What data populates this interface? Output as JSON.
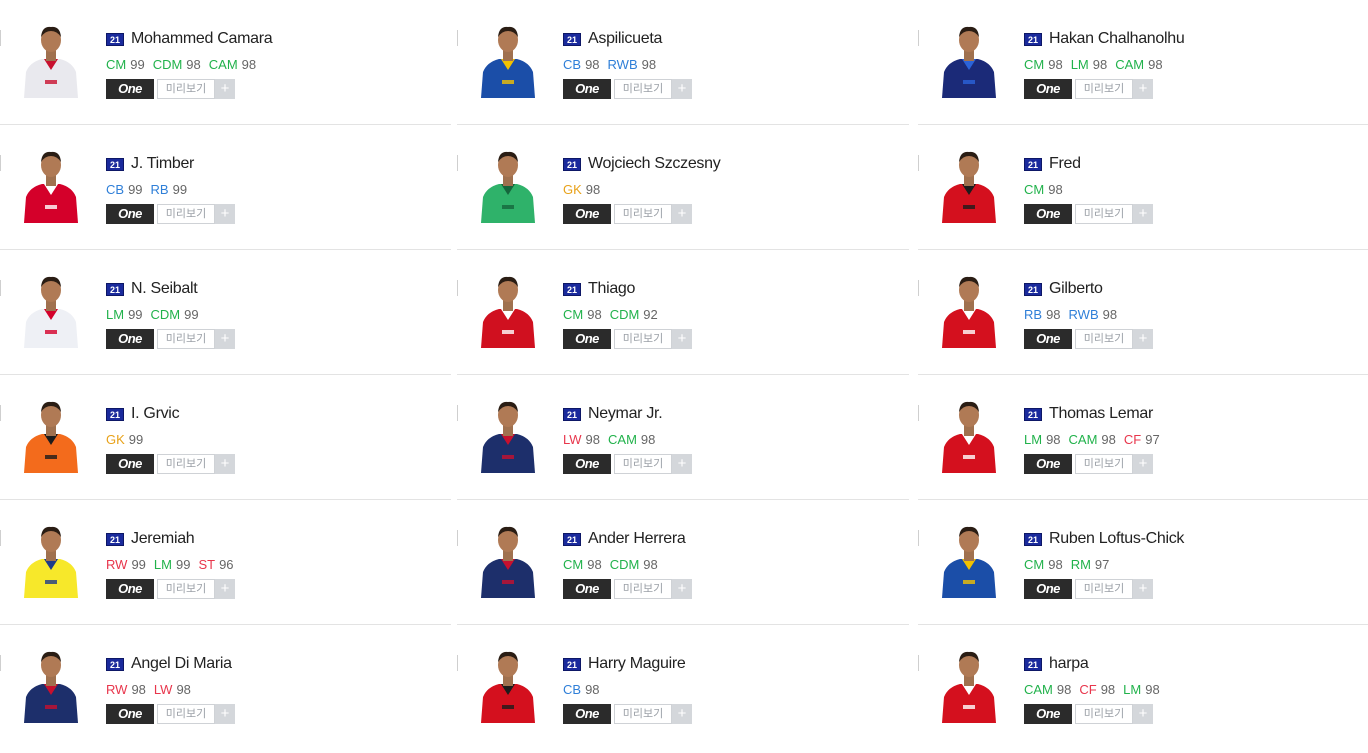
{
  "colors": {
    "CM": "#21b24b",
    "CDM": "#21b24b",
    "CAM": "#21b24b",
    "LM": "#21b24b",
    "RM": "#21b24b",
    "CB": "#2f7fd8",
    "RB": "#2f7fd8",
    "RWB": "#2f7fd8",
    "GK": "#e8a21a",
    "RW": "#e8364c",
    "LW": "#e8364c",
    "ST": "#e8364c",
    "CF": "#e8364c"
  },
  "labels": {
    "season": "21",
    "one": "One",
    "preview": "미리보기",
    "plus": "+"
  },
  "columns": [
    [
      {
        "name": "Mohammed Camara",
        "kit": "#e9e9ee",
        "kit2": "#c8102e",
        "positions": [
          {
            "code": "CM",
            "ovr": "99"
          },
          {
            "code": "CDM",
            "ovr": "98"
          },
          {
            "code": "CAM",
            "ovr": "98"
          }
        ]
      },
      {
        "name": "J. Timber",
        "kit": "#d4002a",
        "kit2": "#ffffff",
        "positions": [
          {
            "code": "CB",
            "ovr": "99"
          },
          {
            "code": "RB",
            "ovr": "99"
          }
        ]
      },
      {
        "name": "N. Seibalt",
        "kit": "#eef0f5",
        "kit2": "#d4002a",
        "positions": [
          {
            "code": "LM",
            "ovr": "99"
          },
          {
            "code": "CDM",
            "ovr": "99"
          }
        ]
      },
      {
        "name": "I. Grvic",
        "kit": "#f36b1c",
        "kit2": "#1c1c1c",
        "positions": [
          {
            "code": "GK",
            "ovr": "99"
          }
        ]
      },
      {
        "name": "Jeremiah",
        "kit": "#f7e82a",
        "kit2": "#1e3a8a",
        "positions": [
          {
            "code": "RW",
            "ovr": "99"
          },
          {
            "code": "LM",
            "ovr": "99"
          },
          {
            "code": "ST",
            "ovr": "96"
          }
        ]
      },
      {
        "name": "Angel Di Maria",
        "kit": "#1d2f6b",
        "kit2": "#c8102e",
        "positions": [
          {
            "code": "RW",
            "ovr": "98"
          },
          {
            "code": "LW",
            "ovr": "98"
          }
        ]
      }
    ],
    [
      {
        "name": "Aspilicueta",
        "kit": "#1b4ea8",
        "kit2": "#f2c200",
        "positions": [
          {
            "code": "CB",
            "ovr": "98"
          },
          {
            "code": "RWB",
            "ovr": "98"
          }
        ]
      },
      {
        "name": "Wojciech Szczesny",
        "kit": "#2fb26a",
        "kit2": "#15663c",
        "positions": [
          {
            "code": "GK",
            "ovr": "98"
          }
        ]
      },
      {
        "name": "Thiago",
        "kit": "#d0101f",
        "kit2": "#ffffff",
        "positions": [
          {
            "code": "CM",
            "ovr": "98"
          },
          {
            "code": "CDM",
            "ovr": "92"
          }
        ]
      },
      {
        "name": "Neymar Jr.",
        "kit": "#1d2f6b",
        "kit2": "#c8102e",
        "positions": [
          {
            "code": "LW",
            "ovr": "98"
          },
          {
            "code": "CAM",
            "ovr": "98"
          }
        ]
      },
      {
        "name": "Ander Herrera",
        "kit": "#1d2f6b",
        "kit2": "#c8102e",
        "positions": [
          {
            "code": "CM",
            "ovr": "98"
          },
          {
            "code": "CDM",
            "ovr": "98"
          }
        ]
      },
      {
        "name": "Harry Maguire",
        "kit": "#d4101e",
        "kit2": "#1c1c1c",
        "positions": [
          {
            "code": "CB",
            "ovr": "98"
          }
        ]
      }
    ],
    [
      {
        "name": "Hakan Chalhanolhu",
        "kit": "#1b2a78",
        "kit2": "#2b63d9",
        "positions": [
          {
            "code": "CM",
            "ovr": "98"
          },
          {
            "code": "LM",
            "ovr": "98"
          },
          {
            "code": "CAM",
            "ovr": "98"
          }
        ]
      },
      {
        "name": "Fred",
        "kit": "#d4101e",
        "kit2": "#1c1c1c",
        "positions": [
          {
            "code": "CM",
            "ovr": "98"
          }
        ]
      },
      {
        "name": "Gilberto",
        "kit": "#d4101e",
        "kit2": "#ffffff",
        "positions": [
          {
            "code": "RB",
            "ovr": "98"
          },
          {
            "code": "RWB",
            "ovr": "98"
          }
        ]
      },
      {
        "name": "Thomas Lemar",
        "kit": "#d4101e",
        "kit2": "#ffffff",
        "positions": [
          {
            "code": "LM",
            "ovr": "98"
          },
          {
            "code": "CAM",
            "ovr": "98"
          },
          {
            "code": "CF",
            "ovr": "97"
          }
        ]
      },
      {
        "name": "Ruben Loftus-Chick",
        "kit": "#1b4ea8",
        "kit2": "#f2c200",
        "positions": [
          {
            "code": "CM",
            "ovr": "98"
          },
          {
            "code": "RM",
            "ovr": "97"
          }
        ]
      },
      {
        "name": "harpa",
        "kit": "#d4101e",
        "kit2": "#ffffff",
        "positions": [
          {
            "code": "CAM",
            "ovr": "98"
          },
          {
            "code": "CF",
            "ovr": "98"
          },
          {
            "code": "LM",
            "ovr": "98"
          }
        ]
      }
    ]
  ]
}
